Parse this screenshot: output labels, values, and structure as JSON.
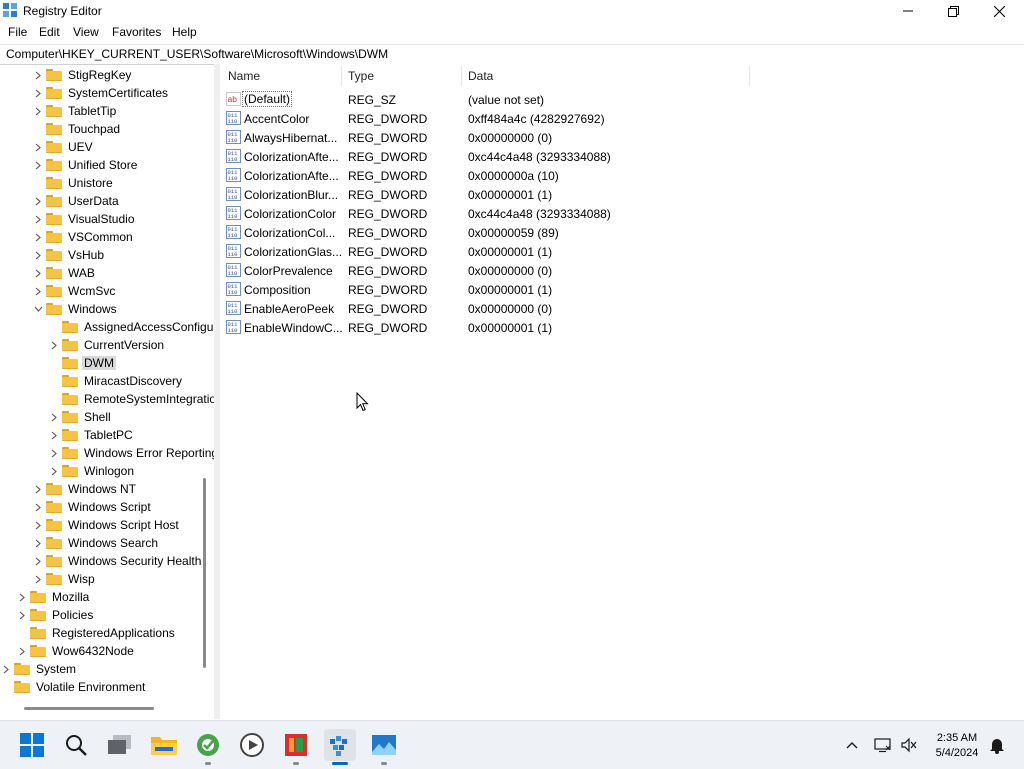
{
  "window": {
    "title": "Registry Editor",
    "menu": [
      "File",
      "Edit",
      "View",
      "Favorites",
      "Help"
    ],
    "address": "Computer\\HKEY_CURRENT_USER\\Software\\Microsoft\\Windows\\DWM"
  },
  "tree": [
    {
      "label": "StigRegKey",
      "expander": "collapsed"
    },
    {
      "label": "SystemCertificates",
      "expander": "collapsed"
    },
    {
      "label": "TabletTip",
      "expander": "collapsed"
    },
    {
      "label": "Touchpad",
      "expander": "none"
    },
    {
      "label": "UEV",
      "expander": "collapsed"
    },
    {
      "label": "Unified Store",
      "expander": "collapsed"
    },
    {
      "label": "Unistore",
      "expander": "none"
    },
    {
      "label": "UserData",
      "expander": "collapsed"
    },
    {
      "label": "VisualStudio",
      "expander": "collapsed"
    },
    {
      "label": "VSCommon",
      "expander": "collapsed"
    },
    {
      "label": "VsHub",
      "expander": "collapsed"
    },
    {
      "label": "WAB",
      "expander": "collapsed"
    },
    {
      "label": "WcmSvc",
      "expander": "collapsed"
    },
    {
      "label": "Windows",
      "expander": "expanded"
    },
    {
      "label": "AssignedAccessConfiguration",
      "expander": "none"
    },
    {
      "label": "CurrentVersion",
      "expander": "collapsed"
    },
    {
      "label": "DWM",
      "expander": "none",
      "selected": true
    },
    {
      "label": "MiracastDiscovery",
      "expander": "none"
    },
    {
      "label": "RemoteSystemIntegration",
      "expander": "none"
    },
    {
      "label": "Shell",
      "expander": "collapsed"
    },
    {
      "label": "TabletPC",
      "expander": "collapsed"
    },
    {
      "label": "Windows Error Reporting",
      "expander": "collapsed"
    },
    {
      "label": "Winlogon",
      "expander": "collapsed"
    },
    {
      "label": "Windows NT",
      "expander": "collapsed"
    },
    {
      "label": "Windows Script",
      "expander": "collapsed"
    },
    {
      "label": "Windows Script Host",
      "expander": "collapsed"
    },
    {
      "label": "Windows Search",
      "expander": "collapsed"
    },
    {
      "label": "Windows Security Health",
      "expander": "collapsed"
    },
    {
      "label": "Wisp",
      "expander": "collapsed"
    },
    {
      "label": "Mozilla",
      "expander": "collapsed"
    },
    {
      "label": "Policies",
      "expander": "collapsed"
    },
    {
      "label": "RegisteredApplications",
      "expander": "none"
    },
    {
      "label": "Wow6432Node",
      "expander": "collapsed"
    },
    {
      "label": "System",
      "expander": "collapsed"
    },
    {
      "label": "Volatile Environment",
      "expander": "none"
    }
  ],
  "columns": {
    "name": "Name",
    "type": "Type",
    "data": "Data"
  },
  "values": [
    {
      "name": "(Default)",
      "type": "REG_SZ",
      "data": "(value not set)",
      "icon": "string-value-icon"
    },
    {
      "name": "AccentColor",
      "type": "REG_DWORD",
      "data": "0xff484a4c (4282927692)",
      "icon": "binary-value-icon"
    },
    {
      "name": "AlwaysHibernat...",
      "type": "REG_DWORD",
      "data": "0x00000000 (0)",
      "icon": "binary-value-icon"
    },
    {
      "name": "ColorizationAfte...",
      "type": "REG_DWORD",
      "data": "0xc44c4a48 (3293334088)",
      "icon": "binary-value-icon"
    },
    {
      "name": "ColorizationAfte...",
      "type": "REG_DWORD",
      "data": "0x0000000a (10)",
      "icon": "binary-value-icon"
    },
    {
      "name": "ColorizationBlur...",
      "type": "REG_DWORD",
      "data": "0x00000001 (1)",
      "icon": "binary-value-icon"
    },
    {
      "name": "ColorizationColor",
      "type": "REG_DWORD",
      "data": "0xc44c4a48 (3293334088)",
      "icon": "binary-value-icon"
    },
    {
      "name": "ColorizationCol...",
      "type": "REG_DWORD",
      "data": "0x00000059 (89)",
      "icon": "binary-value-icon"
    },
    {
      "name": "ColorizationGlas...",
      "type": "REG_DWORD",
      "data": "0x00000001 (1)",
      "icon": "binary-value-icon"
    },
    {
      "name": "ColorPrevalence",
      "type": "REG_DWORD",
      "data": "0x00000000 (0)",
      "icon": "binary-value-icon"
    },
    {
      "name": "Composition",
      "type": "REG_DWORD",
      "data": "0x00000001 (1)",
      "icon": "binary-value-icon"
    },
    {
      "name": "EnableAeroPeek",
      "type": "REG_DWORD",
      "data": "0x00000000 (0)",
      "icon": "binary-value-icon"
    },
    {
      "name": "EnableWindowC...",
      "type": "REG_DWORD",
      "data": "0x00000001 (1)",
      "icon": "binary-value-icon"
    }
  ],
  "taskbar": {
    "apps": [
      "start-button",
      "search-button",
      "task-view-button",
      "file-explorer-button",
      "browser-button",
      "media-player-button",
      "app-button",
      "registry-editor-button",
      "image-app-button"
    ],
    "time": "2:35 AM",
    "date": "5/4/2024"
  },
  "colors": {
    "accent": "#0067c0",
    "folder": "#f6c444",
    "selection": "#d9d9d9"
  }
}
